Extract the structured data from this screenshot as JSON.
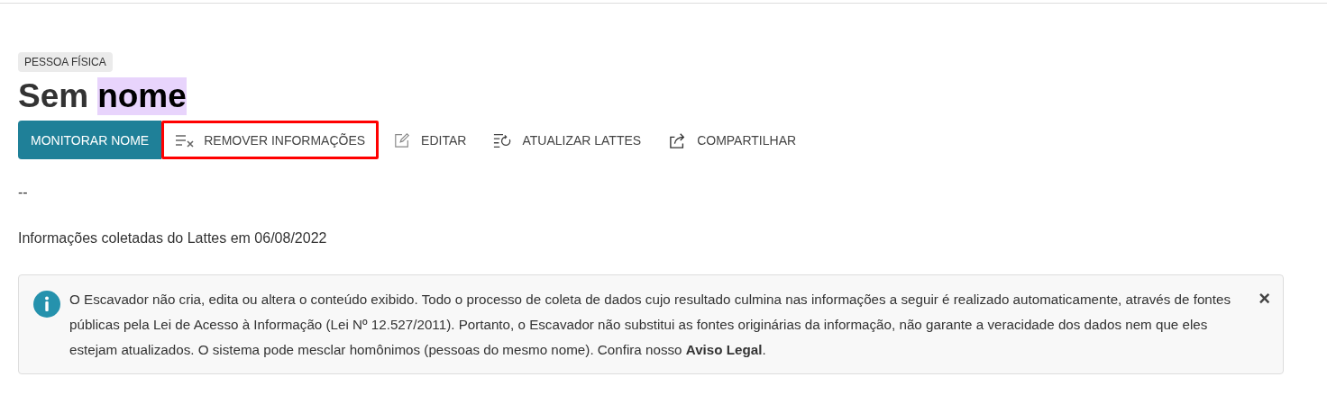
{
  "badge": "PESSOA FÍSICA",
  "title_parts": [
    {
      "text": "Sem",
      "highlighted": false
    },
    {
      "text": "nome",
      "highlighted": true
    }
  ],
  "actions": [
    {
      "label": "MONITORAR NOME",
      "kind": "primary",
      "outlined": false
    },
    {
      "label": "REMOVER INFORMAÇÕES",
      "kind": "remove",
      "outlined": true
    },
    {
      "label": "EDITAR",
      "kind": "edit",
      "outlined": false
    },
    {
      "label": "ATUALIZAR LATTES",
      "kind": "refresh",
      "outlined": false
    },
    {
      "label": "COMPARTILHAR",
      "kind": "share",
      "outlined": false
    }
  ],
  "subtitle": "--",
  "collected": "Informações coletadas do Lattes em 06/08/2022",
  "notice": {
    "text": "O Escavador não cria, edita ou altera o conteúdo exibido. Todo o processo de coleta de dados cujo resultado culmina nas informações a seguir é realizado automaticamente, através de fontes públicas pela Lei de Acesso à Informação (Lei Nº 12.527/2011). Portanto, o Escavador não substitui as fontes originárias da informação, não garante a veracidade dos dados nem que eles estejam atualizados. O sistema pode mesclar homônimos (pessoas do mesmo nome). Confira nosso **Aviso Legal**.",
    "close": "×"
  }
}
